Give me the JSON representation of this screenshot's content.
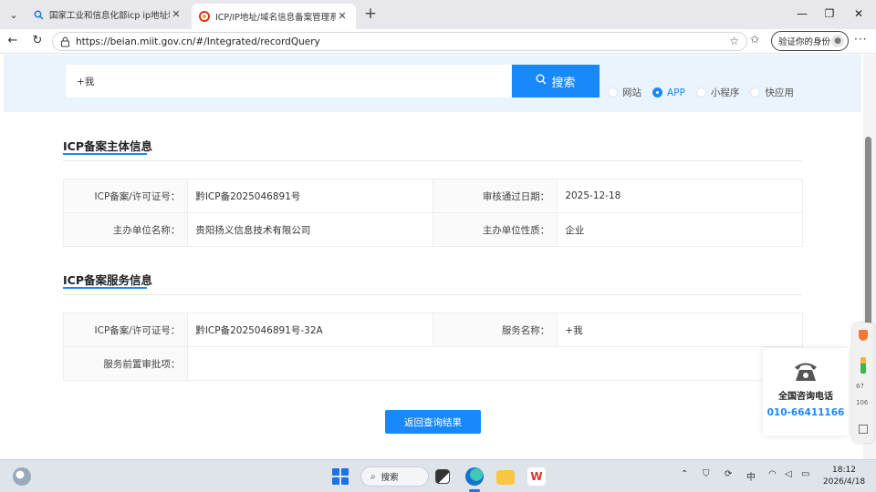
{
  "browser": {
    "tabs": [
      {
        "title": "国家工业和信息化部icp ip地址域名",
        "close": "✕",
        "active": false
      },
      {
        "title": "ICP/IP地址/域名信息备案管理系统",
        "close": "✕",
        "active": true
      }
    ],
    "new_tab": "+",
    "url": "https://beian.miit.gov.cn/#/Integrated/recordQuery",
    "profile_label": "验证你的身份",
    "window_controls": {
      "minimize": "—",
      "maximize": "❐",
      "close": "✕"
    }
  },
  "search": {
    "value": "+我",
    "button_label": "搜索",
    "options": [
      {
        "label": "网站",
        "checked": false
      },
      {
        "label": "APP",
        "checked": true
      },
      {
        "label": "小程序",
        "checked": false
      },
      {
        "label": "快应用",
        "checked": false
      }
    ]
  },
  "subject": {
    "title": "ICP备案主体信息",
    "rows": [
      [
        {
          "k": "ICP备案/许可证号：",
          "v": "黔ICP备2025046891号"
        },
        {
          "k": "审核通过日期：",
          "v": "2025-12-18"
        }
      ],
      [
        {
          "k": "主办单位名称：",
          "v": "贵阳扬义信息技术有限公司"
        },
        {
          "k": "主办单位性质：",
          "v": "企业"
        }
      ]
    ]
  },
  "service": {
    "title": "ICP备案服务信息",
    "rows": [
      [
        {
          "k": "ICP备案/许可证号：",
          "v": "黔ICP备2025046891号-32A"
        },
        {
          "k": "服务名称：",
          "v": "+我"
        }
      ],
      [
        {
          "k": "服务前置审批项：",
          "v": ""
        }
      ]
    ]
  },
  "back_button": "返回查询结果",
  "consult": {
    "label": "全国咨询电话",
    "number": "010-66411166"
  },
  "side_widget": {
    "n1": "67",
    "n2": "106"
  },
  "taskbar": {
    "search_label": "搜索",
    "wps_label": "W",
    "ime": "中",
    "time": "18:12",
    "date": "2026/4/18"
  },
  "colors": {
    "accent": "#1989fa",
    "band": "#e9f4fd"
  }
}
